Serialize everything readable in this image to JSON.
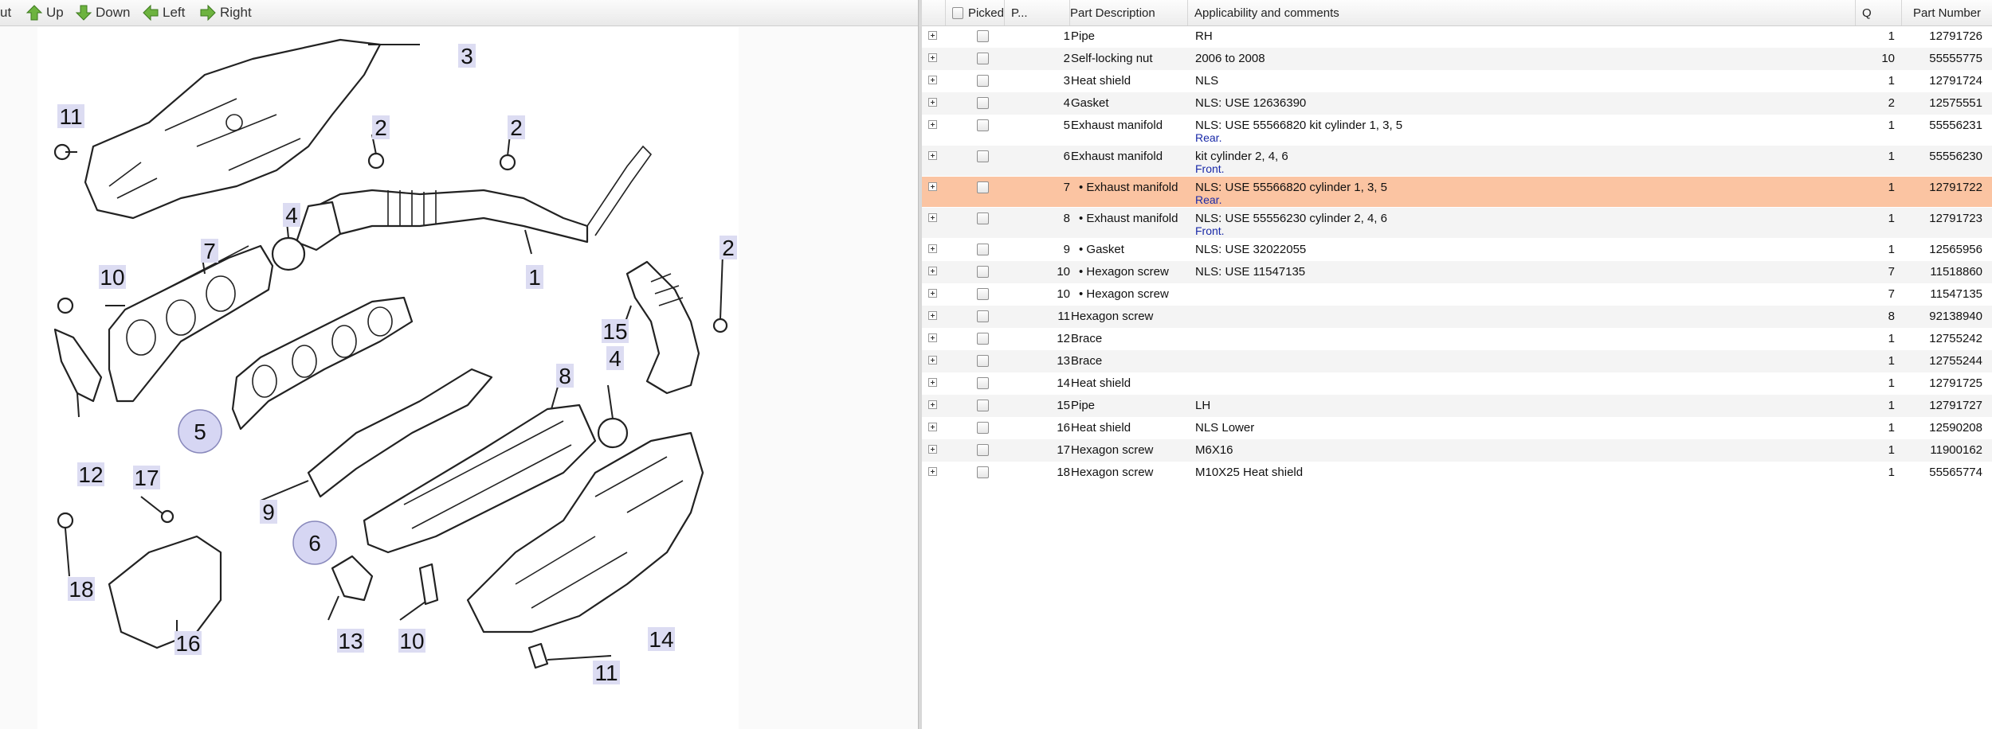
{
  "toolbar": {
    "cut_label": "ut",
    "up_label": "Up",
    "down_label": "Down",
    "left_label": "Left",
    "right_label": "Right"
  },
  "diagram": {
    "callouts": [
      "3",
      "11",
      "2",
      "2",
      "4",
      "7",
      "10",
      "1",
      "2",
      "15",
      "4",
      "8",
      "5",
      "12",
      "9",
      "17",
      "6",
      "18",
      "13",
      "10",
      "14",
      "11",
      "16"
    ]
  },
  "grid": {
    "headers": {
      "picked": "Picked",
      "pos": "P...",
      "description": "Part Description",
      "applicability": "Applicability and comments",
      "qty": "Q",
      "part_number": "Part Number"
    },
    "rows": [
      {
        "num": "1",
        "desc": "Pipe",
        "appl": "RH",
        "note": "",
        "qty": "1",
        "pn": "12791726"
      },
      {
        "num": "2",
        "desc": "Self-locking nut",
        "appl": "2006 to 2008",
        "note": "",
        "qty": "10",
        "pn": "55555775"
      },
      {
        "num": "3",
        "desc": "Heat shield",
        "appl": "NLS",
        "note": "",
        "qty": "1",
        "pn": "12791724"
      },
      {
        "num": "4",
        "desc": "Gasket",
        "appl": "NLS: USE 12636390",
        "note": "",
        "qty": "2",
        "pn": "12575551"
      },
      {
        "num": "5",
        "desc": "Exhaust manifold",
        "appl": "NLS: USE 55566820 kit cylinder 1, 3, 5",
        "note": "Rear.",
        "qty": "1",
        "pn": "55556231"
      },
      {
        "num": "6",
        "desc": "Exhaust manifold",
        "appl": "kit cylinder 2, 4, 6",
        "note": "Front.",
        "qty": "1",
        "pn": "55556230"
      },
      {
        "num": "7",
        "desc": "• Exhaust manifold",
        "appl": "NLS: USE 55566820 cylinder 1, 3, 5",
        "note": "Rear.",
        "qty": "1",
        "pn": "12791722"
      },
      {
        "num": "8",
        "desc": "• Exhaust manifold",
        "appl": "NLS: USE 55556230 cylinder 2, 4, 6",
        "note": "Front.",
        "qty": "1",
        "pn": "12791723"
      },
      {
        "num": "9",
        "desc": "• Gasket",
        "appl": "NLS: USE 32022055",
        "note": "",
        "qty": "1",
        "pn": "12565956"
      },
      {
        "num": "10",
        "desc": "• Hexagon screw",
        "appl": "NLS: USE 11547135",
        "note": "",
        "qty": "7",
        "pn": "11518860"
      },
      {
        "num": "10",
        "desc": "• Hexagon screw",
        "appl": "",
        "note": "",
        "qty": "7",
        "pn": "11547135"
      },
      {
        "num": "11",
        "desc": "Hexagon screw",
        "appl": "",
        "note": "",
        "qty": "8",
        "pn": "92138940"
      },
      {
        "num": "12",
        "desc": "Brace",
        "appl": "",
        "note": "",
        "qty": "1",
        "pn": "12755242"
      },
      {
        "num": "13",
        "desc": "Brace",
        "appl": "",
        "note": "",
        "qty": "1",
        "pn": "12755244"
      },
      {
        "num": "14",
        "desc": "Heat shield",
        "appl": "",
        "note": "",
        "qty": "1",
        "pn": "12791725"
      },
      {
        "num": "15",
        "desc": "Pipe",
        "appl": "LH",
        "note": "",
        "qty": "1",
        "pn": "12791727"
      },
      {
        "num": "16",
        "desc": "Heat shield",
        "appl": "NLS Lower",
        "note": "",
        "qty": "1",
        "pn": "12590208"
      },
      {
        "num": "17",
        "desc": "Hexagon screw",
        "appl": "M6X16",
        "note": "",
        "qty": "1",
        "pn": "11900162"
      },
      {
        "num": "18",
        "desc": "Hexagon screw",
        "appl": "M10X25 Heat shield",
        "note": "",
        "qty": "1",
        "pn": "55565774"
      }
    ]
  },
  "colors": {
    "selected_row": "#fbc4a2",
    "note_text": "#1a2aa8",
    "callout_bg": "#dcdcf2",
    "arrow_green": "#5aa032"
  }
}
